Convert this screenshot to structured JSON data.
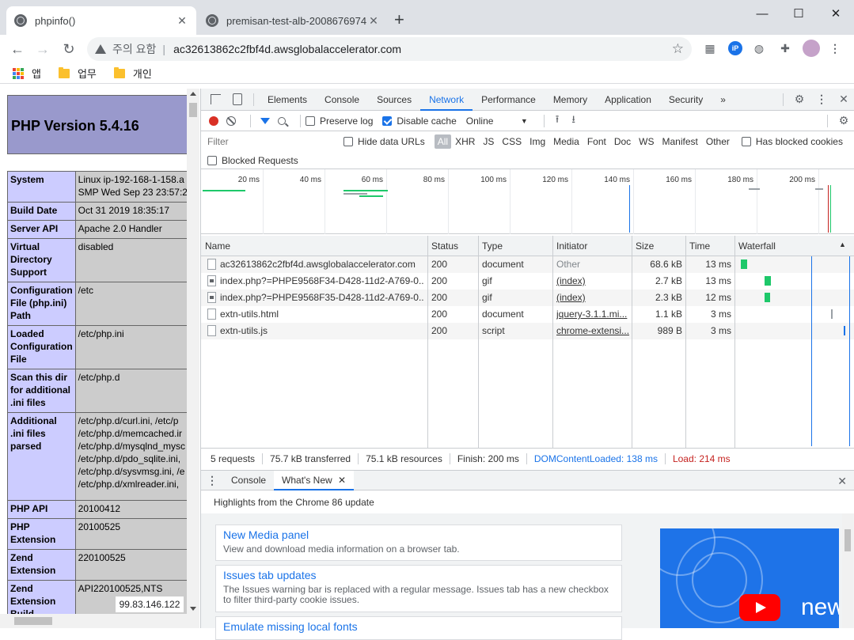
{
  "browser": {
    "tabs": [
      {
        "title": "phpinfo()",
        "active": true
      },
      {
        "title": "premisan-test-alb-2008676974.u",
        "active": false
      }
    ],
    "new_tab": "+",
    "window_controls": {
      "minimize": "—",
      "maximize": "☐",
      "close": "✕"
    },
    "omnibox": {
      "security_label": "주의 요함",
      "separator": "|",
      "url": "ac32613862c2fbf4d.awsglobalaccelerator.com"
    },
    "bookmarks": [
      "앱",
      "업무",
      "개인"
    ]
  },
  "phpinfo": {
    "version_title": "PHP Version 5.4.16",
    "rows": [
      {
        "key": "System",
        "value": "Linux ip-192-168-1-158.a\nSMP Wed Sep 23 23:57:2"
      },
      {
        "key": "Build Date",
        "value": "Oct 31 2019 18:35:17"
      },
      {
        "key": "Server API",
        "value": "Apache 2.0 Handler"
      },
      {
        "key": "Virtual Directory Support",
        "value": "disabled"
      },
      {
        "key": "Configuration File (php.ini) Path",
        "value": "/etc"
      },
      {
        "key": "Loaded Configuration File",
        "value": "/etc/php.ini"
      },
      {
        "key": "Scan this dir for additional .ini files",
        "value": "/etc/php.d"
      },
      {
        "key": "Additional .ini files parsed",
        "value": "/etc/php.d/curl.ini, /etc/p\n/etc/php.d/memcached.ir\n/etc/php.d/mysqlnd_mysc\n/etc/php.d/pdo_sqlite.ini,\n/etc/php.d/sysvmsg.ini, /e\n/etc/php.d/xmlreader.ini,"
      },
      {
        "key": "PHP API",
        "value": "20100412"
      },
      {
        "key": "PHP Extension",
        "value": "20100525"
      },
      {
        "key": "Zend Extension",
        "value": "220100525"
      },
      {
        "key": "Zend Extension Build",
        "value": "API220100525,NTS"
      }
    ],
    "ip_overlay": "99.83.146.122"
  },
  "devtools": {
    "tabs": [
      "Elements",
      "Console",
      "Sources",
      "Network",
      "Performance",
      "Memory",
      "Application",
      "Security"
    ],
    "more": "»",
    "selected_tab": "Network",
    "toolbar": {
      "preserve_log": "Preserve log",
      "disable_cache": "Disable cache",
      "throttle": "Online"
    },
    "filter": {
      "placeholder": "Filter",
      "hide_data_urls": "Hide data URLs",
      "types": [
        "All",
        "XHR",
        "JS",
        "CSS",
        "Img",
        "Media",
        "Font",
        "Doc",
        "WS",
        "Manifest",
        "Other"
      ],
      "has_blocked_cookies": "Has blocked cookies",
      "blocked_requests": "Blocked Requests"
    },
    "overview_ticks": [
      "20 ms",
      "40 ms",
      "60 ms",
      "80 ms",
      "100 ms",
      "120 ms",
      "140 ms",
      "160 ms",
      "180 ms",
      "200 ms"
    ],
    "columns": [
      "Name",
      "Status",
      "Type",
      "Initiator",
      "Size",
      "Time",
      "Waterfall"
    ],
    "requests": [
      {
        "name": "ac32613862c2fbf4d.awsglobalaccelerator.com",
        "status": "200",
        "type": "document",
        "initiator": "Other",
        "size": "68.6 kB",
        "time": "13 ms"
      },
      {
        "name": "index.php?=PHPE9568F34-D428-11d2-A769-0...",
        "status": "200",
        "type": "gif",
        "initiator": "(index)",
        "size": "2.7 kB",
        "time": "13 ms"
      },
      {
        "name": "index.php?=PHPE9568F35-D428-11d2-A769-0...",
        "status": "200",
        "type": "gif",
        "initiator": "(index)",
        "size": "2.3 kB",
        "time": "12 ms"
      },
      {
        "name": "extn-utils.html",
        "status": "200",
        "type": "document",
        "initiator": "jquery-3.1.1.mi...",
        "size": "1.1 kB",
        "time": "3 ms"
      },
      {
        "name": "extn-utils.js",
        "status": "200",
        "type": "script",
        "initiator": "chrome-extensi...",
        "size": "989 B",
        "time": "3 ms"
      }
    ],
    "summary": {
      "requests": "5 requests",
      "transferred": "75.7 kB transferred",
      "resources": "75.1 kB resources",
      "finish": "Finish: 200 ms",
      "dom_content_loaded": "DOMContentLoaded: 138 ms",
      "load": "Load: 214 ms"
    },
    "drawer": {
      "tabs": [
        "Console",
        "What's New"
      ],
      "selected": "What's New",
      "close_x": "✕",
      "highlights": "Highlights from the Chrome 86 update",
      "cards": [
        {
          "title": "New Media panel",
          "desc": "View and download media information on a browser tab."
        },
        {
          "title": "Issues tab updates",
          "desc": "The Issues warning bar is replaced with a regular message. Issues tab has a new checkbox to filter third-party cookie issues."
        },
        {
          "title": "Emulate missing local fonts",
          "desc": ""
        }
      ],
      "video_text": "new"
    }
  },
  "colors": {
    "php_header": "#9999cc",
    "php_key": "#ccccff",
    "php_value": "#cccccc",
    "accent": "#1a73e8",
    "record": "#d93025",
    "dcl_blue": "#1a73e8",
    "load_red": "#c5221f",
    "waterfall_green": "#1ec86a"
  }
}
